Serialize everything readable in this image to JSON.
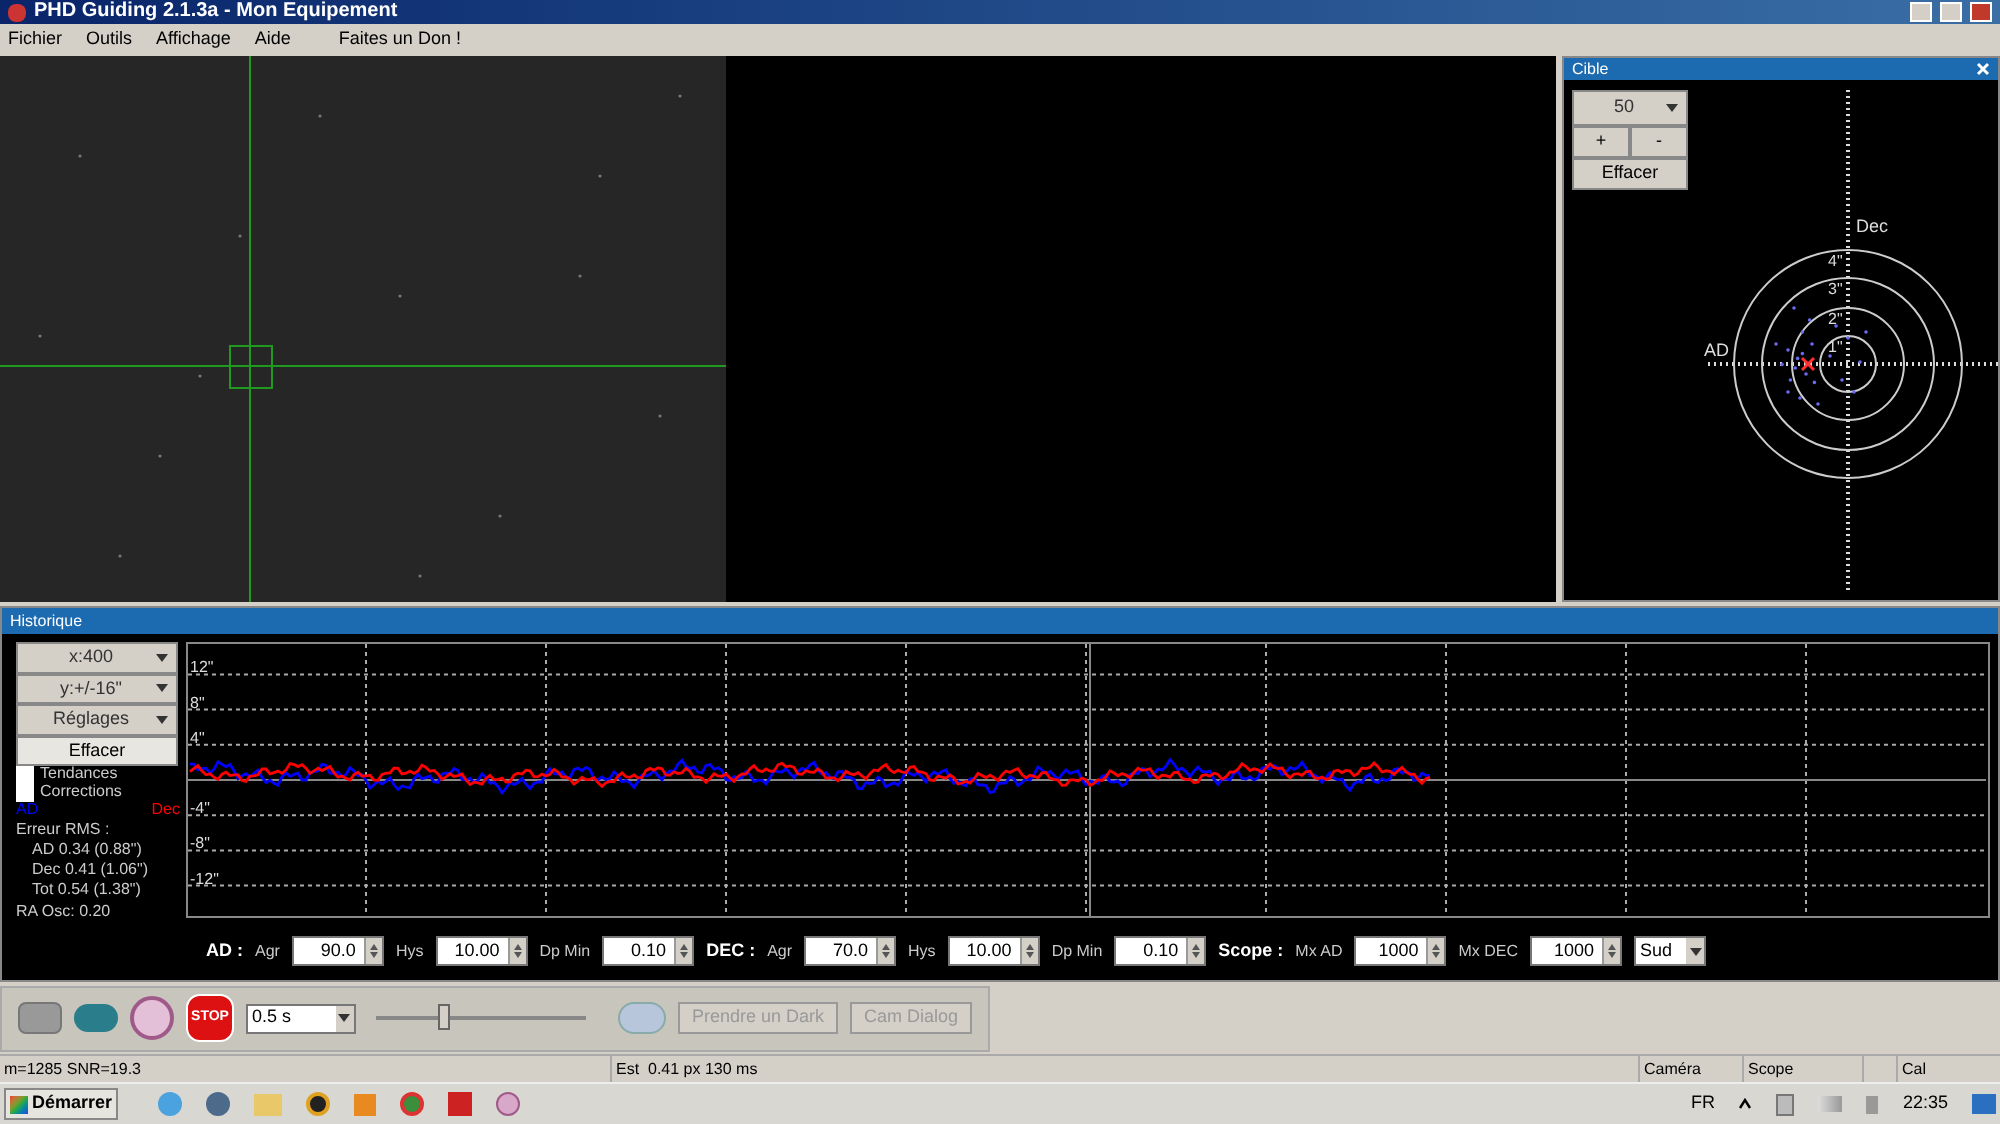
{
  "window": {
    "title": "PHD Guiding 2.1.3a - Mon Equipement"
  },
  "menu": [
    "Fichier",
    "Outils",
    "Affichage",
    "Aide",
    "Faites un Don !"
  ],
  "target_panel": {
    "title": "Cible",
    "length_select": "50",
    "buttons": [
      "+",
      "-",
      "Effacer"
    ],
    "ra_label": "AD",
    "dec_label": "Dec",
    "ring_labels": [
      "4\"",
      "3\"",
      "2\"",
      "1\""
    ]
  },
  "history": {
    "title": "Historique",
    "dropdowns": [
      "x:400",
      "y:+/-16\"",
      "Réglages"
    ],
    "clear_button": "Effacer",
    "checkboxes": [
      {
        "label": "Tendances",
        "checked": false
      },
      {
        "label": "Corrections",
        "checked": false
      }
    ],
    "legend": [
      {
        "label": "AD",
        "color": "#0000ff"
      },
      {
        "label": "Dec",
        "color": "#ff0000"
      }
    ],
    "rms_title": "Erreur RMS :",
    "rms": [
      "AD 0.34 (0.88\")",
      "Dec 0.41 (1.06\")",
      "Tot 0.54 (1.38\")"
    ],
    "ra_osc": "RA Osc: 0.20",
    "y_labels": [
      "12\"",
      "8\"",
      "4\"",
      "-4\"",
      "-8\"",
      "-12\""
    ]
  },
  "params": {
    "groups": [
      {
        "label": "AD :",
        "fields": [
          {
            "label": "Agr",
            "value": "90.0"
          },
          {
            "label": "Hys",
            "value": "10.00"
          },
          {
            "label": "Dp Min",
            "value": "0.10"
          }
        ]
      },
      {
        "label": "DEC :",
        "fields": [
          {
            "label": "Agr",
            "value": "70.0"
          },
          {
            "label": "Hys",
            "value": "10.00"
          },
          {
            "label": "Dp Min",
            "value": "0.10"
          }
        ]
      },
      {
        "label": "Scope :",
        "fields": [
          {
            "label": "Mx AD",
            "value": "1000"
          },
          {
            "label": "Mx DEC",
            "value": "1000"
          }
        ]
      }
    ],
    "dec_mode": "Sud"
  },
  "toolbar": {
    "stop_label": "STOP",
    "exposure": "0.5 s",
    "slider": {
      "level": 0.3
    },
    "buttons": [
      {
        "label": "Prendre un Dark",
        "disabled": true
      },
      {
        "label": "Cam Dialog",
        "disabled": true
      }
    ]
  },
  "status_bar": {
    "star": "m=1285 SNR=19.3",
    "estimate": "Est  0.41 px 130 ms",
    "panes": [
      "Caméra",
      "Scope",
      "Cal"
    ]
  },
  "taskbar": {
    "start": "Démarrer",
    "language": "FR",
    "clock": "22:35"
  }
}
